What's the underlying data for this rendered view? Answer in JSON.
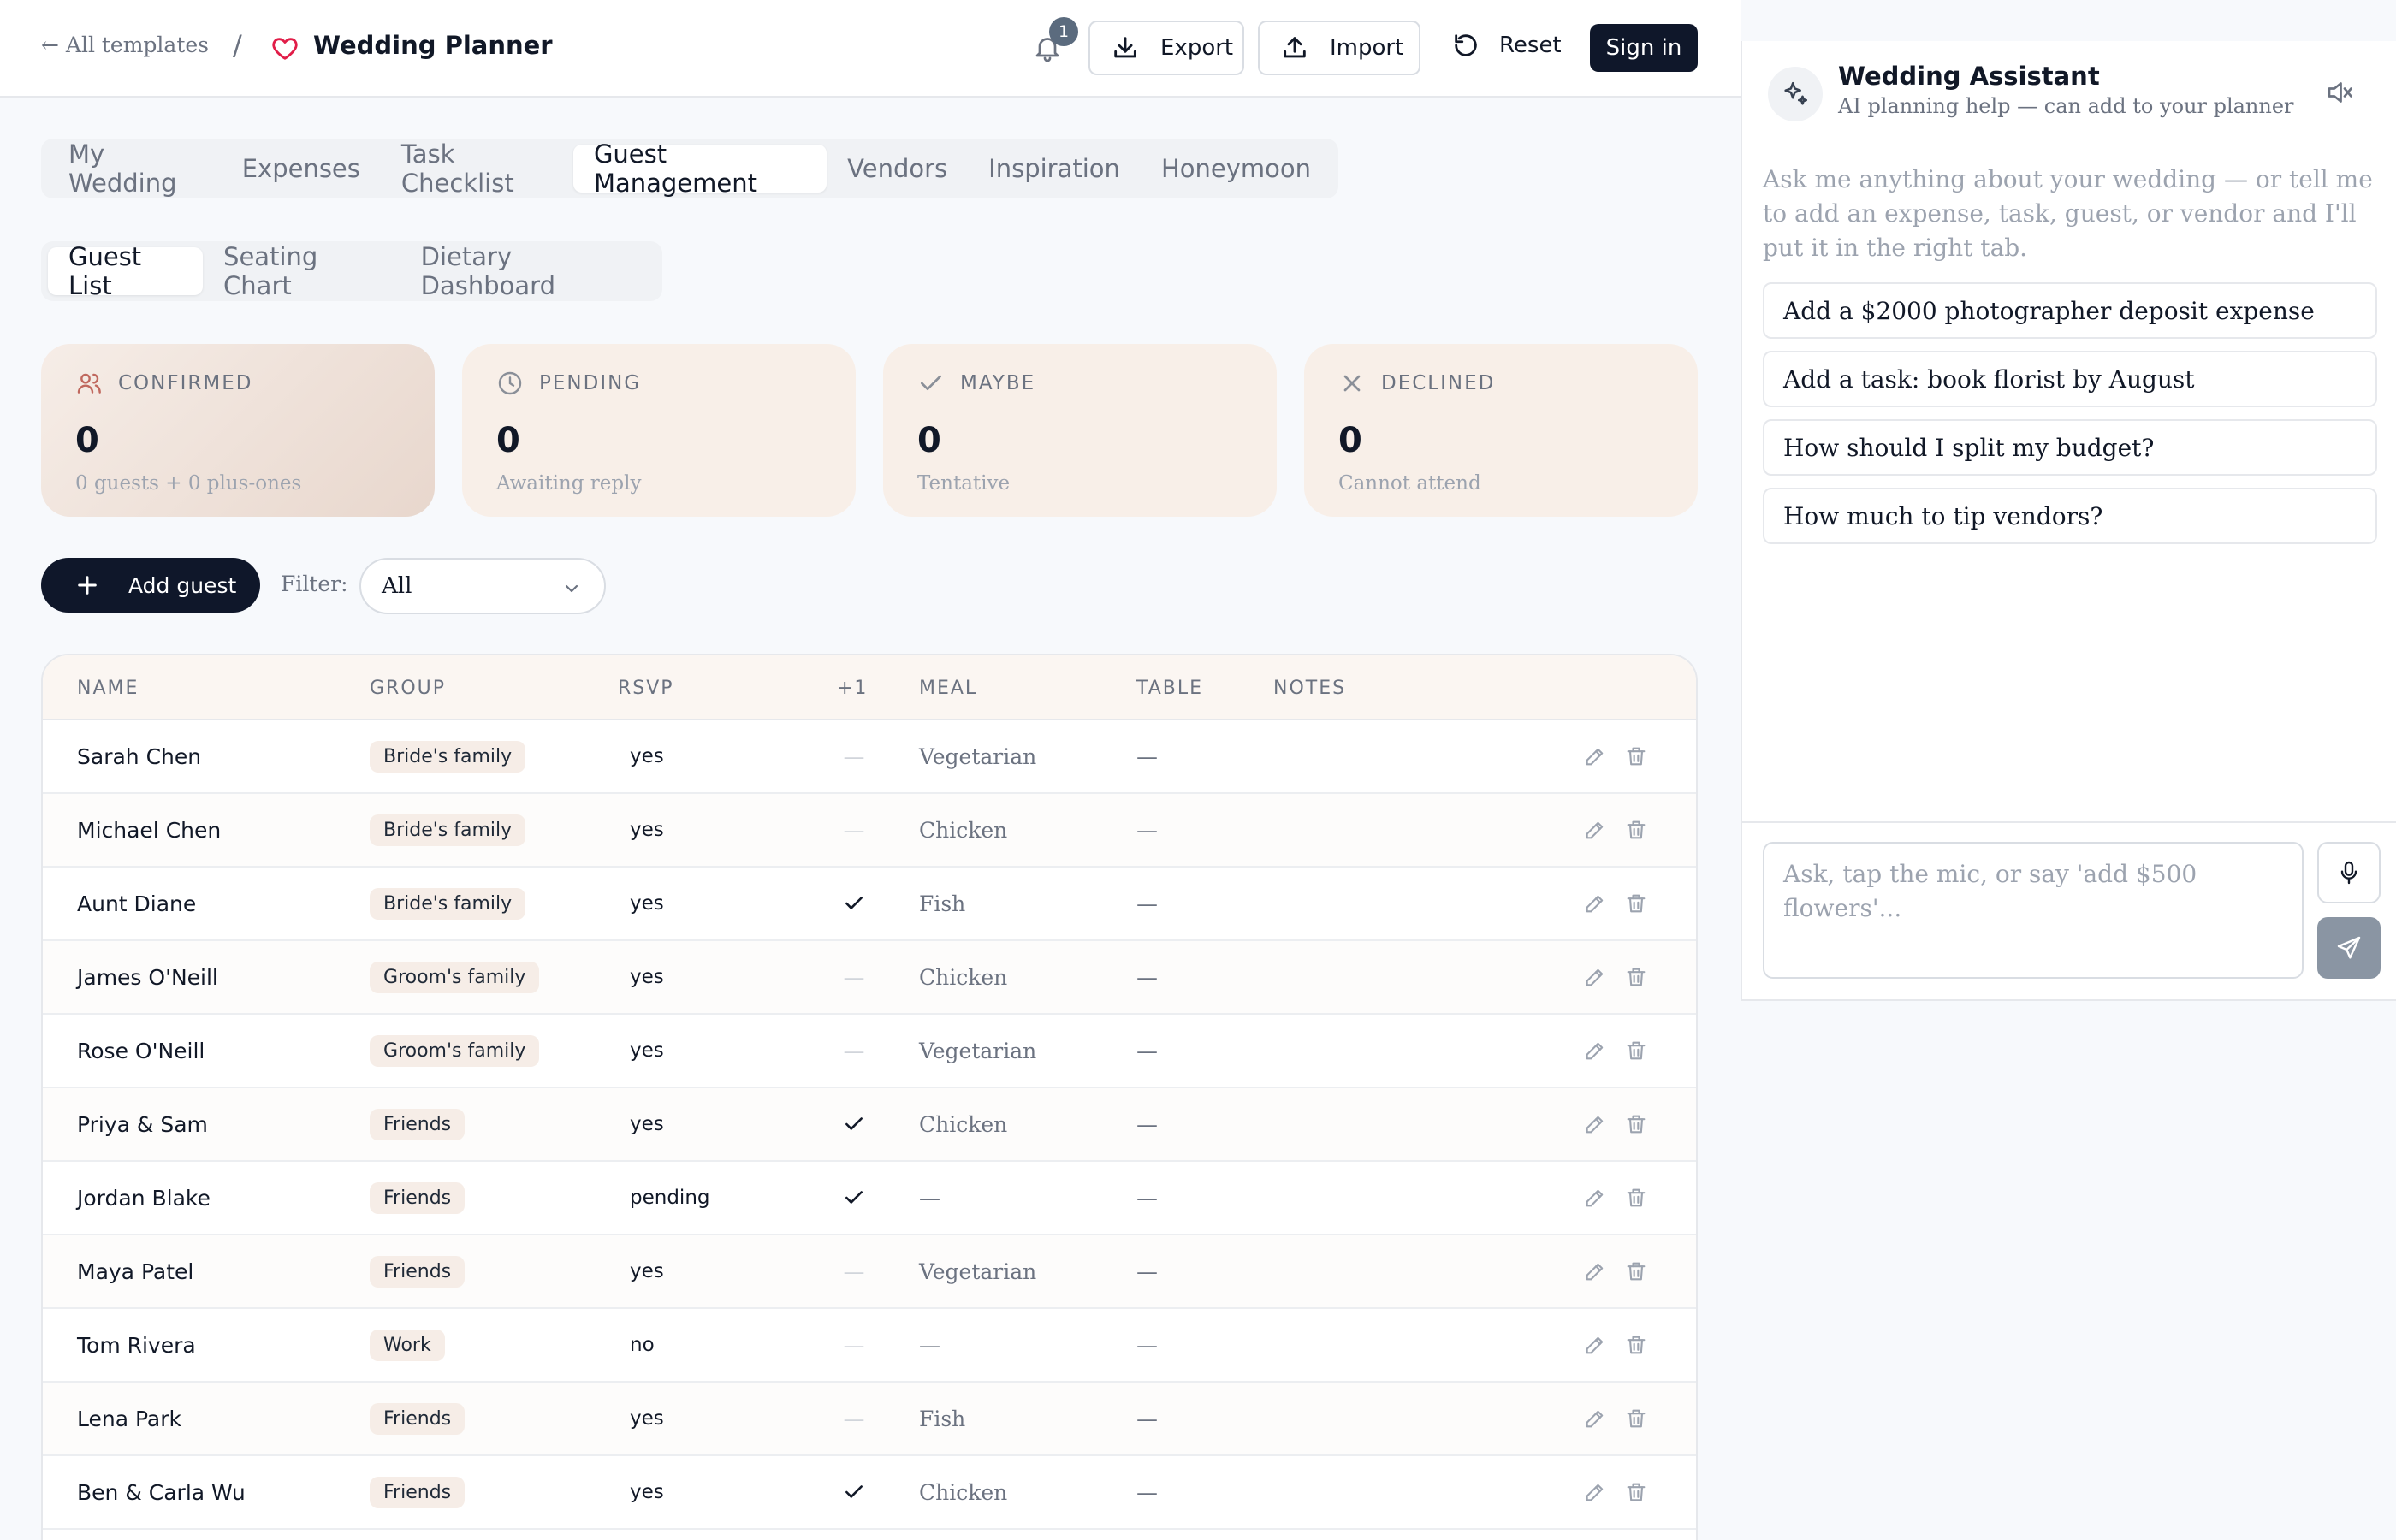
{
  "topbar": {
    "back_label": "← All templates",
    "separator": "/",
    "app_title": "Wedding Planner",
    "notification_count": "1",
    "export_label": "Export",
    "import_label": "Import",
    "reset_label": "Reset",
    "signin_label": "Sign in"
  },
  "main_tabs": [
    "My Wedding",
    "Expenses",
    "Task Checklist",
    "Guest Management",
    "Vendors",
    "Inspiration",
    "Honeymoon"
  ],
  "main_tab_active": "Guest Management",
  "sub_tabs": [
    "Guest List",
    "Seating Chart",
    "Dietary Dashboard"
  ],
  "sub_tab_active": "Guest List",
  "stats": [
    {
      "label": "CONFIRMED",
      "value": "0",
      "sub": "0 guests + 0 plus-ones",
      "icon": "users-icon"
    },
    {
      "label": "PENDING",
      "value": "0",
      "sub": "Awaiting reply",
      "icon": "clock-icon"
    },
    {
      "label": "MAYBE",
      "value": "0",
      "sub": "Tentative",
      "icon": "check-icon"
    },
    {
      "label": "DECLINED",
      "value": "0",
      "sub": "Cannot attend",
      "icon": "x-icon"
    }
  ],
  "actions": {
    "add_guest_label": "Add guest",
    "filter_label": "Filter:",
    "filter_value": "All"
  },
  "table": {
    "headers": {
      "name": "NAME",
      "group": "GROUP",
      "rsvp": "RSVP",
      "plus_one": "+1",
      "meal": "MEAL",
      "table": "TABLE",
      "notes": "NOTES"
    },
    "rows": [
      {
        "name": "Sarah Chen",
        "group": "Bride's family",
        "rsvp": "yes",
        "plus_one": false,
        "meal": "Vegetarian",
        "table": "—"
      },
      {
        "name": "Michael Chen",
        "group": "Bride's family",
        "rsvp": "yes",
        "plus_one": false,
        "meal": "Chicken",
        "table": "—"
      },
      {
        "name": "Aunt Diane",
        "group": "Bride's family",
        "rsvp": "yes",
        "plus_one": true,
        "meal": "Fish",
        "table": "—"
      },
      {
        "name": "James O'Neill",
        "group": "Groom's family",
        "rsvp": "yes",
        "plus_one": false,
        "meal": "Chicken",
        "table": "—"
      },
      {
        "name": "Rose O'Neill",
        "group": "Groom's family",
        "rsvp": "yes",
        "plus_one": false,
        "meal": "Vegetarian",
        "table": "—"
      },
      {
        "name": "Priya & Sam",
        "group": "Friends",
        "rsvp": "yes",
        "plus_one": true,
        "meal": "Chicken",
        "table": "—"
      },
      {
        "name": "Jordan Blake",
        "group": "Friends",
        "rsvp": "pending",
        "plus_one": true,
        "meal": "—",
        "table": "—"
      },
      {
        "name": "Maya Patel",
        "group": "Friends",
        "rsvp": "yes",
        "plus_one": false,
        "meal": "Vegetarian",
        "table": "—"
      },
      {
        "name": "Tom Rivera",
        "group": "Work",
        "rsvp": "no",
        "plus_one": false,
        "meal": "—",
        "table": "—"
      },
      {
        "name": "Lena Park",
        "group": "Friends",
        "rsvp": "yes",
        "plus_one": false,
        "meal": "Fish",
        "table": "—"
      },
      {
        "name": "Ben & Carla Wu",
        "group": "Friends",
        "rsvp": "yes",
        "plus_one": true,
        "meal": "Chicken",
        "table": "—"
      }
    ],
    "empty_plus_one": "—"
  },
  "assistant": {
    "title": "Wedding Assistant",
    "subtitle": "AI planning help — can add to your planner",
    "intro": "Ask me anything about your wedding — or tell me to add an expense, task, guest, or vendor and I'll put it in the right tab.",
    "suggestions": [
      "Add a $2000 photographer deposit expense",
      "Add a task: book florist by August",
      "How should I split my budget?",
      "How much to tip vendors?"
    ],
    "input_placeholder": "Ask, tap the mic, or say 'add $500 flowers'..."
  },
  "colors": {
    "primary": "#0f172a",
    "accent_heart": "#e11d48",
    "card_bg": "#f8efe8",
    "pill_bg": "#f6ede7",
    "send_bg": "#8a95a3"
  }
}
